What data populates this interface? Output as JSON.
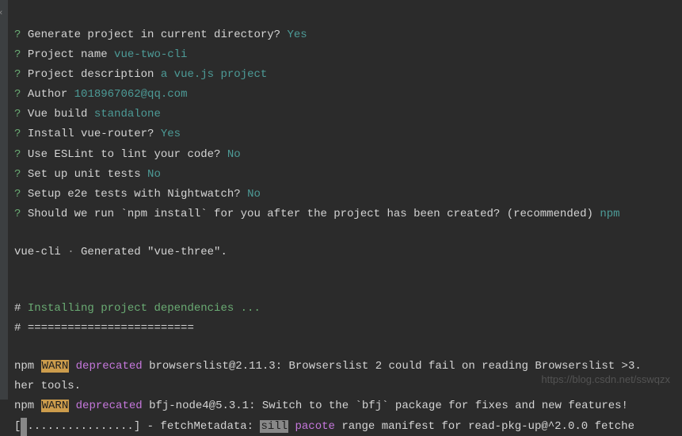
{
  "prompts": [
    {
      "q": "?",
      "label": "Generate project in current directory?",
      "answer": "Yes",
      "answerClass": "teal"
    },
    {
      "q": "?",
      "label": "Project name",
      "answer": "vue-two-cli",
      "answerClass": "teal"
    },
    {
      "q": "?",
      "label": "Project description",
      "answer": "a vue.js project",
      "answerClass": "teal"
    },
    {
      "q": "?",
      "label": "Author",
      "answer": "1018967062@qq.com",
      "answerClass": "teal"
    },
    {
      "q": "?",
      "label": "Vue build",
      "answer": "standalone",
      "answerClass": "teal"
    },
    {
      "q": "?",
      "label": "Install vue-router?",
      "answer": "Yes",
      "answerClass": "teal"
    },
    {
      "q": "?",
      "label": "Use ESLint to lint your code?",
      "answer": "No",
      "answerClass": "teal"
    },
    {
      "q": "?",
      "label": "Set up unit tests",
      "answer": "No",
      "answerClass": "teal"
    },
    {
      "q": "?",
      "label": "Setup e2e tests with Nightwatch?",
      "answer": "No",
      "answerClass": "teal"
    },
    {
      "q": "?",
      "label": "Should we run `npm install` for you after the project has been created? (recommended)",
      "answer": "npm",
      "answerClass": "teal"
    }
  ],
  "generated": {
    "prefix": "   vue-cli",
    "dot": "·",
    "text": "Generated \"vue-three\"."
  },
  "installing": {
    "hash1": "#",
    "label": "Installing project dependencies ...",
    "hash2": "#",
    "divider": "========================="
  },
  "npm": [
    {
      "prefix": "npm",
      "warn": "WARN",
      "tag": "deprecated",
      "text": "browserslist@2.11.3: Browserslist 2 could fail on reading Browserslist >3."
    },
    {
      "textOnly": "her tools."
    },
    {
      "prefix": "npm",
      "warn": "WARN",
      "tag": "deprecated",
      "text": "bfj-node4@5.3.1: Switch to the `bfj` package for fixes and new features!"
    }
  ],
  "progress": {
    "bar": "[ ................] - fetchMetadata:",
    "sill": "sill",
    "pacote": "pacote",
    "rest": "range manifest for read-pkg-up@^2.0.0 fetche"
  },
  "watermark": "https://blog.csdn.net/sswqzx"
}
